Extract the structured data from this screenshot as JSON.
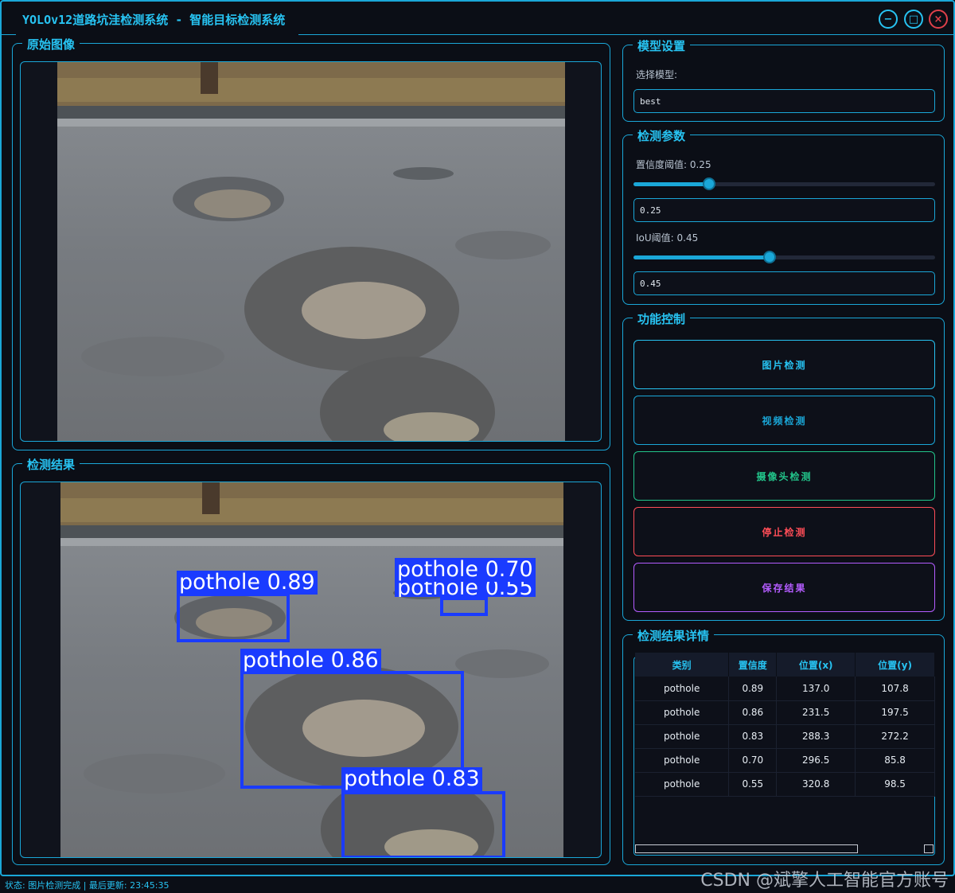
{
  "window": {
    "title": "YOLOv12道路坑洼检测系统 - 智能目标检测系统",
    "accent": "#1aa7d8",
    "minimize_label": "−",
    "maximize_label": "□",
    "close_label": "×"
  },
  "original_panel": {
    "title": "原始图像"
  },
  "result_panel": {
    "title": "检测结果"
  },
  "detections": [
    {
      "label": "pothole 0.89"
    },
    {
      "label": "pothole 0.86"
    },
    {
      "label": "pothole 0.83"
    },
    {
      "label": "pothole 0.70"
    },
    {
      "label": "pothole 0.55"
    }
  ],
  "model_settings": {
    "title": "模型设置",
    "select_label": "选择模型:",
    "selected_model": "best"
  },
  "detect_params": {
    "title": "检测参数",
    "confidence_label": "置信度阈值: 0.25",
    "confidence_value": "0.25",
    "confidence_level": 0.25,
    "iou_label": "IoU阈值: 0.45",
    "iou_value": "0.45",
    "iou_level": 0.45
  },
  "controls": {
    "title": "功能控制",
    "image_detect": "图片检测",
    "video_detect": "视频检测",
    "camera_detect": "摄像头检测",
    "stop_detect": "停止检测",
    "save_results": "保存结果",
    "colors": {
      "image": "#27c3f2",
      "video": "#1aa7d8",
      "camera": "#22c48a",
      "stop": "#ff4d57",
      "save": "#b45cff"
    }
  },
  "results_table": {
    "title": "检测结果详情",
    "headers": [
      "类别",
      "置信度",
      "位置(x)",
      "位置(y)"
    ],
    "rows": [
      [
        "pothole",
        "0.89",
        "137.0",
        "107.8"
      ],
      [
        "pothole",
        "0.86",
        "231.5",
        "197.5"
      ],
      [
        "pothole",
        "0.83",
        "288.3",
        "272.2"
      ],
      [
        "pothole",
        "0.70",
        "296.5",
        "85.8"
      ],
      [
        "pothole",
        "0.55",
        "320.8",
        "98.5"
      ]
    ]
  },
  "status_bar": {
    "text": "状态: 图片检测完成 | 最后更新: 23:45:35"
  },
  "watermark": "CSDN @斌擎人工智能官方账号"
}
